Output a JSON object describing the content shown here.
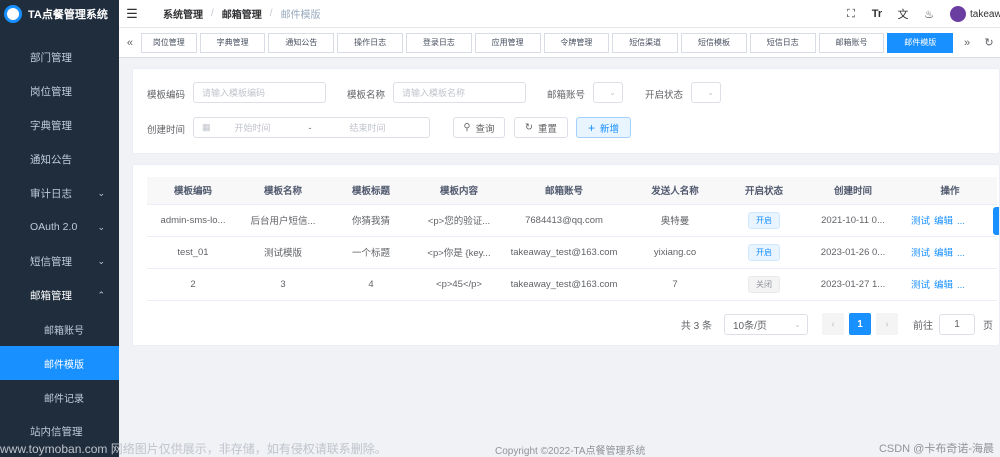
{
  "app": {
    "title": "TA点餐管理系统"
  },
  "sidebar": {
    "items": [
      {
        "label": "部门管理",
        "has_children": false
      },
      {
        "label": "岗位管理",
        "has_children": false
      },
      {
        "label": "字典管理",
        "has_children": false
      },
      {
        "label": "通知公告",
        "has_children": false
      },
      {
        "label": "审计日志",
        "has_children": true
      },
      {
        "label": "OAuth 2.0",
        "has_children": true
      },
      {
        "label": "短信管理",
        "has_children": true
      },
      {
        "label": "邮箱管理",
        "has_children": true,
        "expanded": true
      }
    ],
    "submenu": [
      {
        "label": "邮箱账号",
        "active": false
      },
      {
        "label": "邮件模版",
        "active": true
      },
      {
        "label": "邮件记录",
        "active": false
      }
    ],
    "after": {
      "label": "站内信管理"
    }
  },
  "navbar": {
    "breadcrumb": [
      "系统管理",
      "邮箱管理",
      "邮件模版"
    ],
    "username": "takeaw"
  },
  "tags": [
    {
      "label": "岗位管理",
      "active": false
    },
    {
      "label": "字典管理",
      "active": false
    },
    {
      "label": "通知公告",
      "active": false
    },
    {
      "label": "操作日志",
      "active": false
    },
    {
      "label": "登录日志",
      "active": false
    },
    {
      "label": "应用管理",
      "active": false
    },
    {
      "label": "令牌管理",
      "active": false
    },
    {
      "label": "短信渠道",
      "active": false
    },
    {
      "label": "短信模板",
      "active": false
    },
    {
      "label": "短信日志",
      "active": false
    },
    {
      "label": "邮箱账号",
      "active": false
    },
    {
      "label": "邮件模版",
      "active": true
    }
  ],
  "search": {
    "code_label": "模板编码",
    "code_placeholder": "请输入模板编码",
    "name_label": "模板名称",
    "name_placeholder": "请输入模板名称",
    "account_label": "邮箱账号",
    "status_label": "开启状态",
    "created_label": "创建时间",
    "start_placeholder": "开始时间",
    "range_sep": "-",
    "end_placeholder": "结束时间",
    "query_button": "查询",
    "reset_button": "重置",
    "add_button": "新增"
  },
  "table": {
    "columns": [
      "模板编码",
      "模板名称",
      "模板标题",
      "模板内容",
      "邮箱账号",
      "发送人名称",
      "开启状态",
      "创建时间",
      "操作"
    ],
    "rows": [
      {
        "code": "admin-sms-lo...",
        "name": "后台用户短信...",
        "title": "你猜我猜",
        "content": "<p>您的验证...",
        "account": "7684413@qq.com",
        "sender": "奥特曼",
        "status": "开启",
        "status_on": true,
        "created": "2021-10-11 0..."
      },
      {
        "code": "test_01",
        "name": "测试模版",
        "title": "一个标题",
        "content": "<p>你是 {key...",
        "account": "takeaway_test@163.com",
        "sender": "yixiang.co",
        "status": "开启",
        "status_on": true,
        "created": "2023-01-26 0..."
      },
      {
        "code": "2",
        "name": "3",
        "title": "4",
        "content": "<p>45</p>",
        "account": "takeaway_test@163.com",
        "sender": "7",
        "status": "关闭",
        "status_on": false,
        "created": "2023-01-27 1..."
      }
    ],
    "actions": {
      "test": "测试",
      "edit": "编辑",
      "more": "..."
    }
  },
  "pagination": {
    "total": "共 3 条",
    "page_size": "10条/页",
    "current_page": "1",
    "goto_label": "前往",
    "goto_value": "1",
    "page_suffix": "页"
  },
  "footer": {
    "copyright": "Copyright ©2022-TA点餐管理系统",
    "watermark": "www.toymoban.com 网络图片仅供展示，非存储，如有侵权请联系删除。",
    "credit": "CSDN @卡布奇诺-海晨"
  },
  "colors": {
    "sidebar_bg": "#1f2d3d",
    "accent": "#1890ff"
  }
}
